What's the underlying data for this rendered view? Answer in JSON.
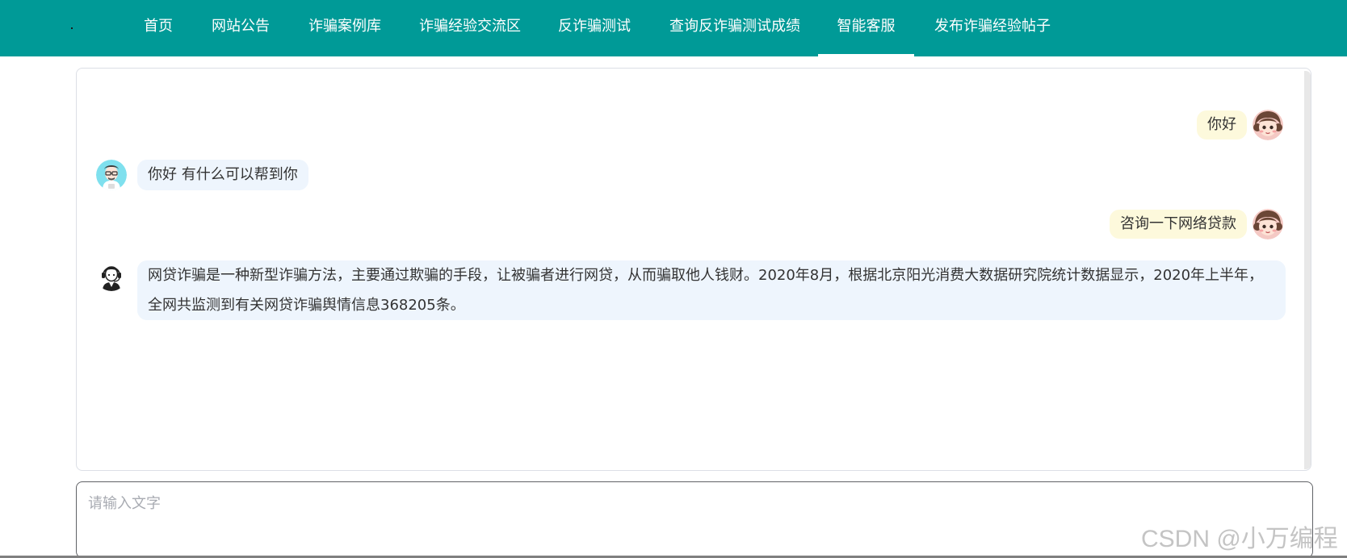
{
  "nav": {
    "items": [
      {
        "label": "首页"
      },
      {
        "label": "网站公告"
      },
      {
        "label": "诈骗案例库"
      },
      {
        "label": "诈骗经验交流区"
      },
      {
        "label": "反诈骗测试"
      },
      {
        "label": "查询反诈骗测试成绩"
      },
      {
        "label": "智能客服",
        "active": true
      },
      {
        "label": "发布诈骗经验帖子"
      }
    ],
    "background": "#009a97"
  },
  "chat": {
    "messages": [
      {
        "role": "user",
        "text": "你好"
      },
      {
        "role": "bot",
        "text": "你好 有什么可以帮到你"
      },
      {
        "role": "user",
        "text": "咨询一下网络贷款"
      },
      {
        "role": "bot",
        "text": "网贷诈骗是一种新型诈骗方法，主要通过欺骗的手段，让被骗者进行网贷，从而骗取他人钱财。2020年8月，根据北京阳光消费大数据研究院统计数据显示，2020年上半年，全网共监测到有关网贷诈骗舆情信息368205条。"
      }
    ],
    "user_bubble_color": "#fdf9dc",
    "bot_bubble_color": "#eef5fd"
  },
  "input": {
    "placeholder": "请输入文字",
    "value": ""
  },
  "watermark": "CSDN @小万编程"
}
